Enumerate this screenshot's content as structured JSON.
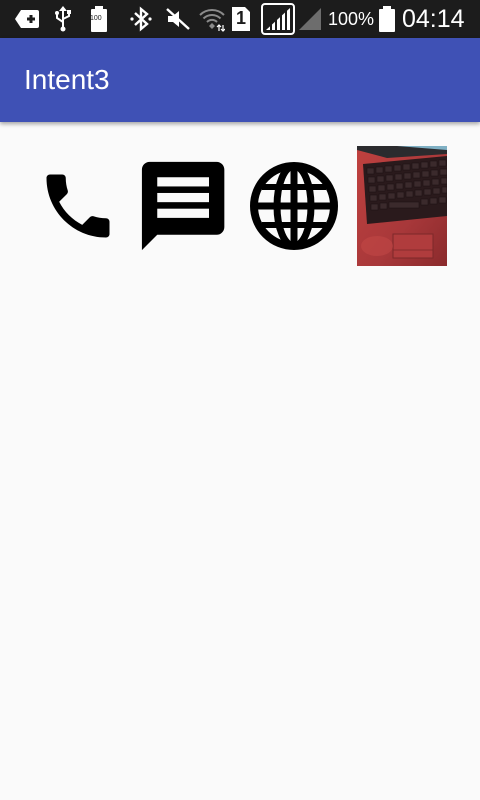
{
  "status_bar": {
    "notification_icons": [
      "add-notification-icon",
      "usb-icon",
      "battery-saver-icon"
    ],
    "battery_saver_label": "100",
    "system_icons": [
      "bluetooth-icon",
      "mute-icon",
      "wifi-icon",
      "sim-icon",
      "signal-icon",
      "signal-empty-icon",
      "battery-icon"
    ],
    "sim_label": "1",
    "battery_percent": "100%",
    "time": "04:14"
  },
  "app_bar": {
    "title": "Intent3",
    "color": "#3f51b5"
  },
  "actions": [
    {
      "name": "call-button",
      "icon": "phone-icon"
    },
    {
      "name": "message-button",
      "icon": "message-icon"
    },
    {
      "name": "web-button",
      "icon": "globe-icon"
    },
    {
      "name": "photo-button",
      "icon": "keyboard-photo-thumbnail"
    }
  ],
  "colors": {
    "status_bar": "#1c1c1c",
    "background": "#fafafa",
    "icon": "#000000"
  }
}
